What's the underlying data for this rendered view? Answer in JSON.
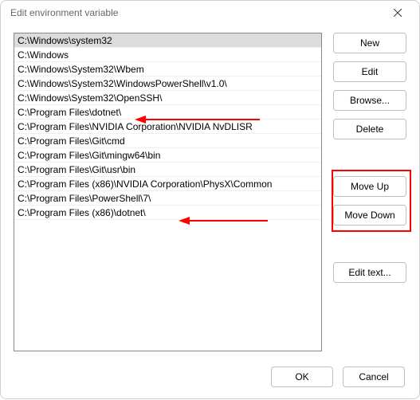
{
  "window": {
    "title": "Edit environment variable"
  },
  "list": {
    "selected_index": 0,
    "items": [
      "C:\\Windows\\system32",
      "C:\\Windows",
      "C:\\Windows\\System32\\Wbem",
      "C:\\Windows\\System32\\WindowsPowerShell\\v1.0\\",
      "C:\\Windows\\System32\\OpenSSH\\",
      "C:\\Program Files\\dotnet\\",
      "C:\\Program Files\\NVIDIA Corporation\\NVIDIA NvDLISR",
      "C:\\Program Files\\Git\\cmd",
      "C:\\Program Files\\Git\\mingw64\\bin",
      "C:\\Program Files\\Git\\usr\\bin",
      "C:\\Program Files (x86)\\NVIDIA Corporation\\PhysX\\Common",
      "C:\\Program Files\\PowerShell\\7\\",
      "C:\\Program Files (x86)\\dotnet\\"
    ]
  },
  "buttons": {
    "new": "New",
    "edit": "Edit",
    "browse": "Browse...",
    "delete": "Delete",
    "moveup": "Move Up",
    "movedown": "Move Down",
    "edittext": "Edit text...",
    "ok": "OK",
    "cancel": "Cancel"
  },
  "annotations": {
    "arrows": [
      {
        "target_index": 5
      },
      {
        "target_index": 12
      }
    ],
    "highlight_buttons": [
      "moveup",
      "movedown"
    ]
  }
}
